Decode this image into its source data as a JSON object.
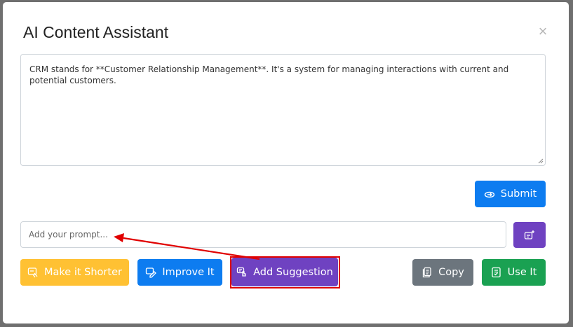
{
  "modal": {
    "title": "AI Content Assistant",
    "close_glyph": "×",
    "content_text": "CRM stands for **Customer Relationship Management**.  It's a system for managing interactions with current and potential customers.",
    "submit_label": "Submit",
    "prompt_placeholder": "Add your prompt...",
    "actions": {
      "make_shorter": "Make it Shorter",
      "improve": "Improve It",
      "add_suggestion": "Add Suggestion",
      "copy": "Copy",
      "use_it": "Use It"
    }
  },
  "colors": {
    "primary": "#0d7cf0",
    "purple": "#6f42c1",
    "warning": "#ffc133",
    "secondary": "#6c757d",
    "success": "#1aa152",
    "annotation": "#e00000"
  },
  "icons": {
    "submit": "ai-send-icon",
    "sparkle": "ai-sparkle-icon",
    "make_shorter": "shorten-icon",
    "improve": "edit-pen-icon",
    "add_suggestion": "suggestion-icon",
    "copy": "copy-icon",
    "use_it": "checklist-icon"
  }
}
